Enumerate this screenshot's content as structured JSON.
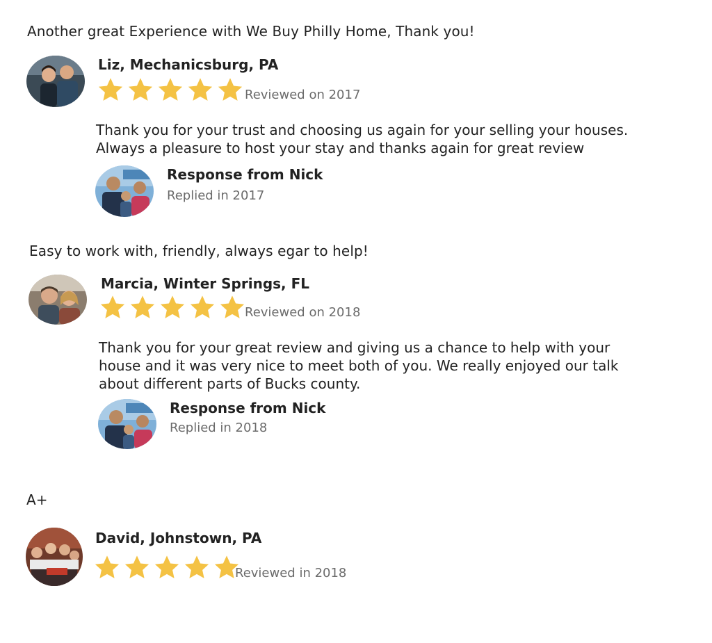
{
  "accent": "#f4c244",
  "reviews": [
    {
      "quote": "Another great Experience with We Buy Philly Home, Thank you!",
      "reviewer": "Liz, Mechanicsburg, PA",
      "avatar_icon": "reviewer-photo-couple",
      "rating": 5,
      "reviewed": "Reviewed on 2017",
      "reply_lines": [
        "Thank you for your trust and choosing us again for your selling your houses.",
        "Always a pleasure to host your stay and thanks again for great review"
      ],
      "responder": "Response from Nick",
      "replied": "Replied in 2017"
    },
    {
      "quote": "Easy to work with, friendly, always egar to help!",
      "reviewer": "Marcia, Winter Springs, FL",
      "avatar_icon": "reviewer-photo-couple",
      "rating": 5,
      "reviewed": "Reviewed on 2018",
      "reply_lines": [
        "Thank you for your great review and giving us a chance to help with your",
        "house and it was very nice to meet both of you. We really enjoyed our talk",
        "about different parts of Bucks county."
      ],
      "responder": "Response from Nick",
      "replied": "Replied in 2018"
    },
    {
      "quote": "A+",
      "reviewer": "David, Johnstown, PA",
      "avatar_icon": "reviewer-photo-family",
      "rating": 5,
      "reviewed": "Reviewed in 2018"
    }
  ]
}
